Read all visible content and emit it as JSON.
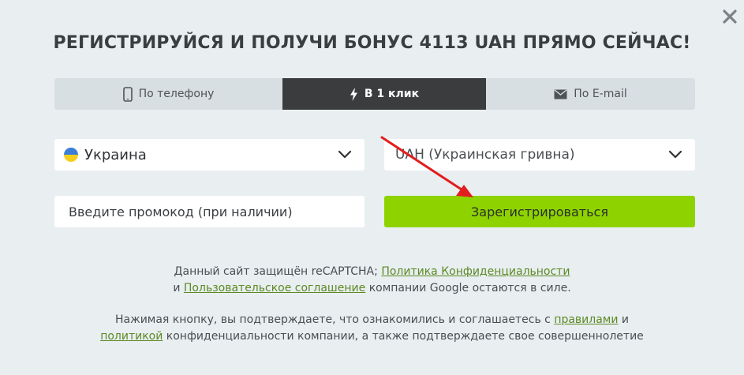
{
  "modal": {
    "title": "РЕГИСТРИРУЙСЯ И ПОЛУЧИ БОНУС 4113 UAH ПРЯМО СЕЙЧАС!",
    "close_icon": "close-icon"
  },
  "tabs": [
    {
      "label": "По телефону",
      "icon": "phone-icon",
      "active": false
    },
    {
      "label": "В 1 клик",
      "icon": "lightning-icon",
      "active": true
    },
    {
      "label": "По E-mail",
      "icon": "envelope-icon",
      "active": false
    }
  ],
  "form": {
    "country": {
      "value": "Украина",
      "flag_colors": [
        "#3d7fd6",
        "#f5cf1e"
      ]
    },
    "currency": {
      "value": "UAH (Украинская гривна)"
    },
    "promo": {
      "placeholder": "Введите промокод (при наличии)",
      "value": ""
    },
    "register_label": "Зарегистрироваться"
  },
  "legal": {
    "recaptcha_1": "Данный сайт защищён reCAPTCHA;",
    "privacy_link": "Политика Конфиденциальности",
    "recaptcha_and": "и",
    "terms_link": "Пользовательское соглашение",
    "recaptcha_2": "компании Google остаются в силе.",
    "consent_1": "Нажимая кнопку, вы подтверждаете, что ознакомились и соглашаетесь с",
    "rules_link": "правилами",
    "consent_and": "и",
    "policy_link": "политикой",
    "consent_2": "конфиденциальности компании, а также подтверждаете свое совершеннолетие"
  },
  "colors": {
    "accent_green": "#8ed300",
    "active_tab": "#3b3c3e",
    "link": "#5b8a23",
    "annotation_arrow": "#e21d1d"
  }
}
